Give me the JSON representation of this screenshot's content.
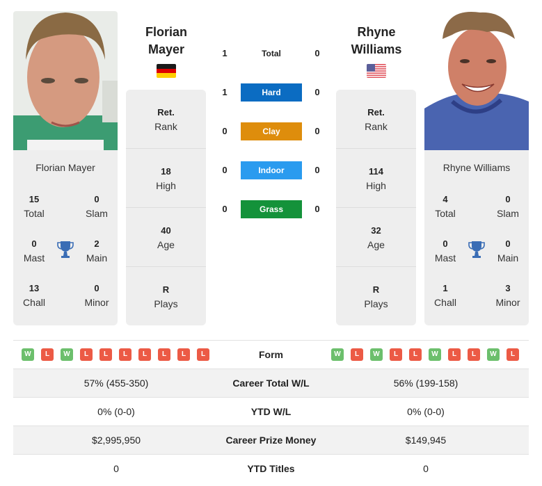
{
  "h2h": {
    "rows": [
      {
        "label": "Total",
        "left": "1",
        "right": "0",
        "color": ""
      },
      {
        "label": "Hard",
        "left": "1",
        "right": "0",
        "color": "#0b6cc2"
      },
      {
        "label": "Clay",
        "left": "0",
        "right": "0",
        "color": "#de8d0c"
      },
      {
        "label": "Indoor",
        "left": "0",
        "right": "0",
        "color": "#2a9bef"
      },
      {
        "label": "Grass",
        "left": "0",
        "right": "0",
        "color": "#14923a"
      }
    ]
  },
  "players": {
    "left": {
      "name_line1": "Florian",
      "name_line2": "Mayer",
      "full_name": "Florian Mayer",
      "country": "Germany",
      "flag_icon": "germany-flag-icon",
      "rank": {
        "value": "Ret.",
        "label": "Rank"
      },
      "high": {
        "value": "18",
        "label": "High"
      },
      "age": {
        "value": "40",
        "label": "Age"
      },
      "plays": {
        "value": "R",
        "label": "Plays"
      },
      "titles": {
        "total": {
          "value": "15",
          "label": "Total"
        },
        "slam": {
          "value": "0",
          "label": "Slam"
        },
        "mast": {
          "value": "0",
          "label": "Mast"
        },
        "main": {
          "value": "2",
          "label": "Main"
        },
        "chall": {
          "value": "13",
          "label": "Chall"
        },
        "minor": {
          "value": "0",
          "label": "Minor"
        }
      },
      "form": [
        "W",
        "L",
        "W",
        "L",
        "L",
        "L",
        "L",
        "L",
        "L",
        "L"
      ]
    },
    "right": {
      "name_line1": "Rhyne",
      "name_line2": "Williams",
      "full_name": "Rhyne Williams",
      "country": "United States",
      "flag_icon": "usa-flag-icon",
      "rank": {
        "value": "Ret.",
        "label": "Rank"
      },
      "high": {
        "value": "114",
        "label": "High"
      },
      "age": {
        "value": "32",
        "label": "Age"
      },
      "plays": {
        "value": "R",
        "label": "Plays"
      },
      "titles": {
        "total": {
          "value": "4",
          "label": "Total"
        },
        "slam": {
          "value": "0",
          "label": "Slam"
        },
        "mast": {
          "value": "0",
          "label": "Mast"
        },
        "main": {
          "value": "0",
          "label": "Main"
        },
        "chall": {
          "value": "1",
          "label": "Chall"
        },
        "minor": {
          "value": "3",
          "label": "Minor"
        }
      },
      "form": [
        "W",
        "L",
        "W",
        "L",
        "L",
        "W",
        "L",
        "L",
        "W",
        "L"
      ]
    }
  },
  "comparison": {
    "form_label": "Form",
    "rows": [
      {
        "label": "Career Total W/L",
        "left": "57% (455-350)",
        "right": "56% (199-158)"
      },
      {
        "label": "YTD W/L",
        "left": "0% (0-0)",
        "right": "0% (0-0)"
      },
      {
        "label": "Career Prize Money",
        "left": "$2,995,950",
        "right": "$149,945"
      },
      {
        "label": "YTD Titles",
        "left": "0",
        "right": "0"
      }
    ]
  },
  "colors": {
    "win": "#6cbf6c",
    "loss": "#ec5a45",
    "card_bg": "#eeeeee",
    "trophy": "#3a6db5"
  }
}
